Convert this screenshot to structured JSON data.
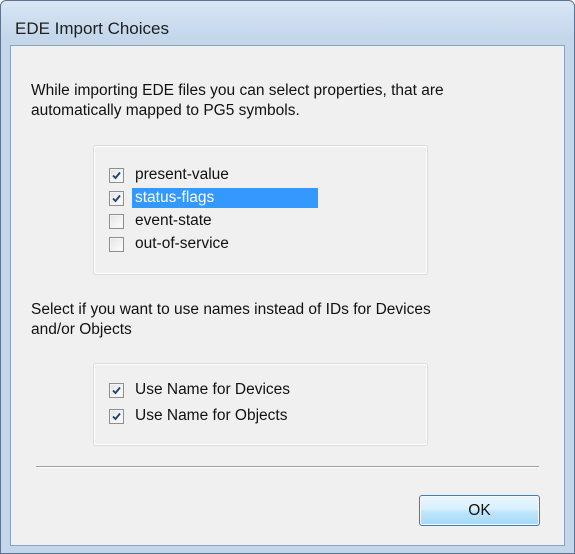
{
  "window": {
    "title": "EDE Import Choices"
  },
  "dialog": {
    "intro_line1": "While importing EDE files you can select properties, that are",
    "intro_line2": "automatically mapped to PG5 symbols.",
    "properties": [
      {
        "label": "present-value",
        "checked": true
      },
      {
        "label": "status-flags",
        "checked": true,
        "selected": true
      },
      {
        "label": "event-state",
        "checked": false
      },
      {
        "label": "out-of-service",
        "checked": false
      }
    ],
    "names_line1": "Select if you want to use names instead of IDs for Devices",
    "names_line2": "and/or Objects",
    "name_options": [
      {
        "label": "Use Name for Devices",
        "checked": true
      },
      {
        "label": "Use Name for Objects",
        "checked": true
      }
    ],
    "ok_label": "OK"
  },
  "colors": {
    "selection": "#3399ff",
    "frame": "#c3d6ea",
    "client": "#f0f0f0"
  }
}
